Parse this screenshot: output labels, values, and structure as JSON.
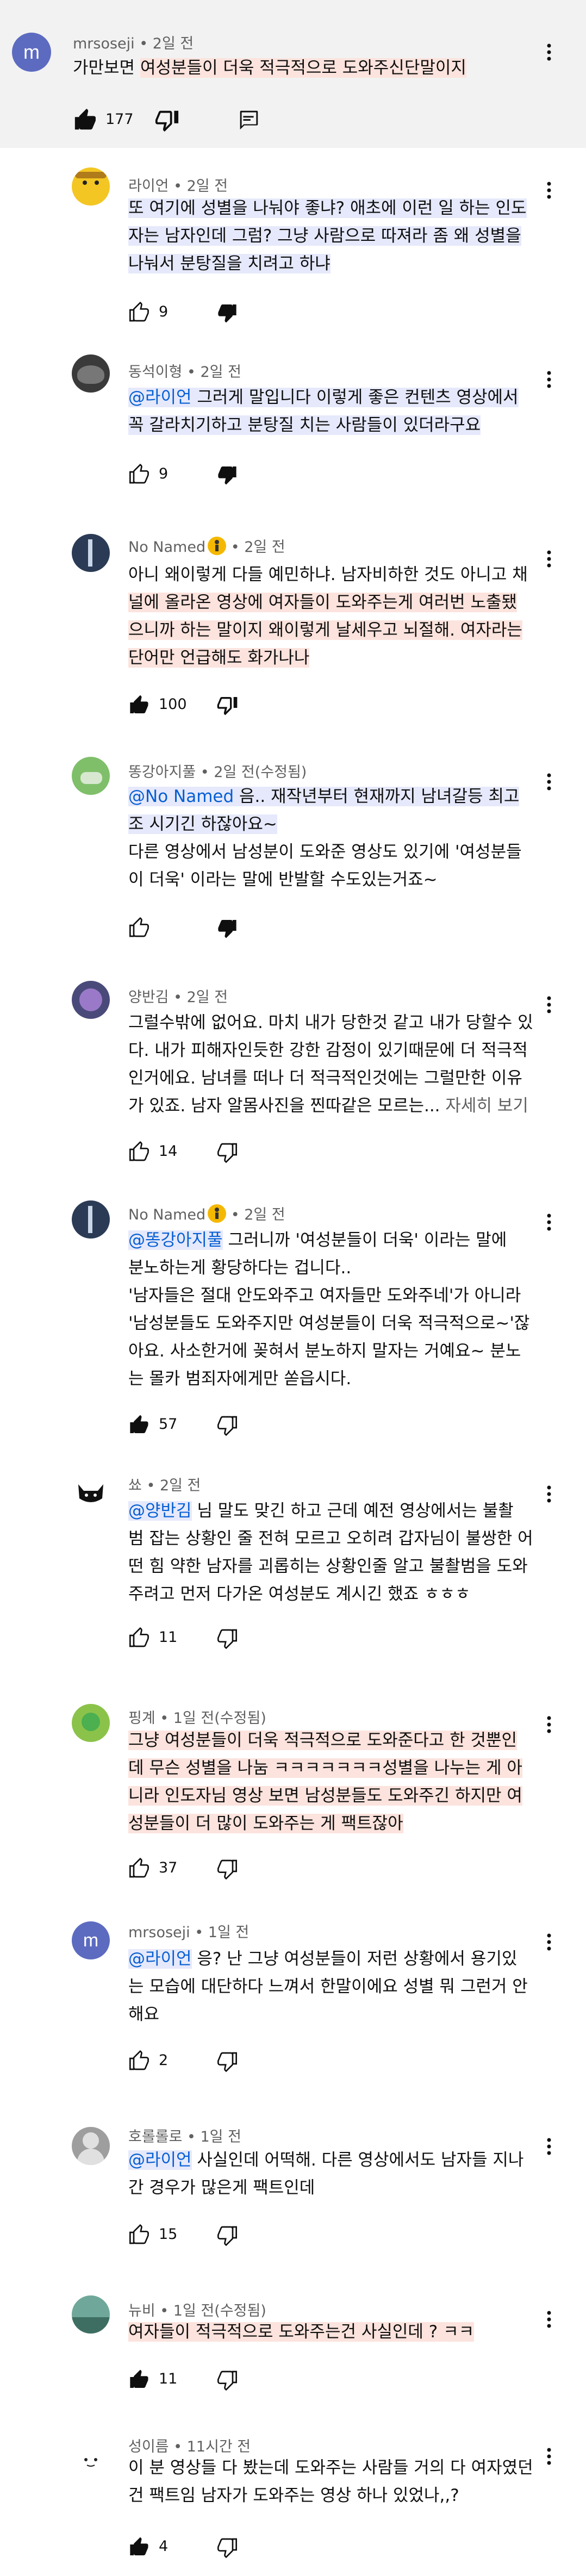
{
  "top_comment": {
    "author": "mrsoseji",
    "time": "• 2일 전",
    "avatar_letter": "m",
    "text_pre": "가만보면 ",
    "text_hl": "여성분들이 더욱 적극적으로 도와주신단말이지",
    "likes": "177"
  },
  "replies": [
    {
      "author": "라이언",
      "time": "• 2일 전",
      "lines": [
        "또 여기에 성별을 나눠야 좋냐? 애초에 이런 일 하는 인도",
        "자는 남자인데 그럼? 그냥 사람으로 따져라 좀 왜 성별을",
        "나눠서 분탕질을 치려고 하냐"
      ],
      "likes": "9"
    },
    {
      "author": "동석이형",
      "time": "• 2일 전",
      "mention": "@라이언",
      "lines": [
        " 그러게 말입니다 이렇게 좋은 컨텐츠 영상에서",
        "꼭 갈라치기하고 분탕질 치는 사람들이 있더라구요"
      ],
      "likes": "9"
    },
    {
      "author": "No Named",
      "time": "• 2일 전",
      "lines": [
        "아니 왜이렇게 다들 예민하냐. 남자비하한 것도 아니고 채",
        "널에 올라온 영상에 여자들이 도와주는게 여러번 노출됐",
        "으니까 하는 말이지 왜이렇게 날세우고 뇌절해. 여자라는",
        "단어만 언급해도 화가나나 "
      ],
      "likes": "100"
    },
    {
      "author": "똥강아지풀",
      "time": "• 2일 전(수정됨)",
      "mention": "@No Named",
      "lines": [
        " 음.. 재작년부터 현재까지 남녀갈등 최고",
        "조 시기긴 하잖아요~",
        "다른 영상에서 남성분이 도와준 영상도 있기에 '여성분들",
        "이 더욱' 이라는 말에 반발할 수도있는거죠~"
      ],
      "likes": ""
    },
    {
      "author": "양반김",
      "time": "• 2일 전",
      "lines": [
        "그럴수밖에 없어요. 마치 내가 당한것 같고 내가 당할수 있",
        "다. 내가 피해자인듯한 강한 감정이 있기때문에 더 적극적",
        "인거에요. 남녀를 떠나 더 적극적인것에는 그럴만한 이유",
        "가 있죠. 남자 알몸사진을 찐따같은 모르는... "
      ],
      "more": "자세히 보기",
      "likes": "14"
    },
    {
      "author": "No Named",
      "time": "• 2일 전",
      "mention": "@똥강아지풀",
      "lines": [
        "  그러니까 '여성분들이 더욱' 이라는 말에",
        "분노하는게 황당하다는 겁니다..",
        " '남자들은 절대 안도와주고 여자들만 도와주네'가 아니라",
        "'남성분들도 도와주지만 여성분들이 더욱 적극적으로~'잖",
        "아요. 사소한거에 꽂혀서 분노하지 말자는 거예요~ 분노",
        "는 몰카 범죄자에게만 쏟읍시다."
      ],
      "likes": "57"
    },
    {
      "author": "쑈",
      "time": "• 2일 전",
      "mention": "@양반김",
      "lines": [
        " 님 말도 맞긴 하고 근데 예전 영상에서는 불촬",
        "범 잡는 상황인 줄 전혀 모르고 오히려 갑자님이 불쌍한 어",
        "떤 힘 약한 남자를 괴롭히는 상황인줄 알고 불촬범을 도와",
        "주려고 먼저 다가온 여성분도 계시긴 했죠 ㅎㅎㅎ"
      ],
      "likes": "11"
    },
    {
      "author": "핑계",
      "time": "• 1일 전(수정됨)",
      "lines": [
        "그냥 여성분들이 더욱 적극적으로 도와준다고 한 것뿐인",
        "데 무슨 성별을 나눔 ㅋㅋㅋㅋㅋㅋㅋ성별을 나누는 게 아",
        "니라 인도자님 영상 보면 남성분들도 도와주긴 하지만 여",
        "성분들이 더 많이 도와주는 게 팩트잖아"
      ],
      "likes": "37"
    },
    {
      "author": "mrsoseji",
      "time": "• 1일 전",
      "avatar_letter": "m",
      "mention": "@라이언",
      "lines": [
        " 응? 난 그냥 여성분들이 저런 상황에서 용기있",
        "는 모습에 대단하다 느껴서 한말이에요 성별 뭐 그런거 안",
        "해요"
      ],
      "likes": "2"
    },
    {
      "author": "호롤롤로",
      "time": "• 1일 전",
      "mention": "@라이언",
      "lines": [
        " 사실인데 어떡해. 다른 영상에서도 남자들 지나",
        "간 경우가 많은게 팩트인데"
      ],
      "likes": "15"
    },
    {
      "author": "뉴비",
      "time": "• 1일 전(수정됨)",
      "lines": [
        "여자들이 적극적으로 도와주는건 사실인데 ? ㅋㅋ"
      ],
      "likes": "11"
    },
    {
      "author": "성이름",
      "time": "• 11시간 전",
      "lines": [
        "이 분 영상들 다 봤는데 도와주는 사람들 거의 다 여자였던",
        "건 팩트임 남자가 도와주는 영상 하나 있었나,,?"
      ],
      "likes": "4"
    }
  ],
  "colors": {
    "accent_blue": "#065fd4",
    "highlight_blue": "#e6e9fb",
    "highlight_orange": "#fce3dd",
    "top_bg": "#f2f2f2"
  },
  "icons": [
    "thumb-up-icon",
    "thumb-down-icon",
    "reply-icon",
    "more-vert-icon",
    "verified-badge-icon"
  ]
}
